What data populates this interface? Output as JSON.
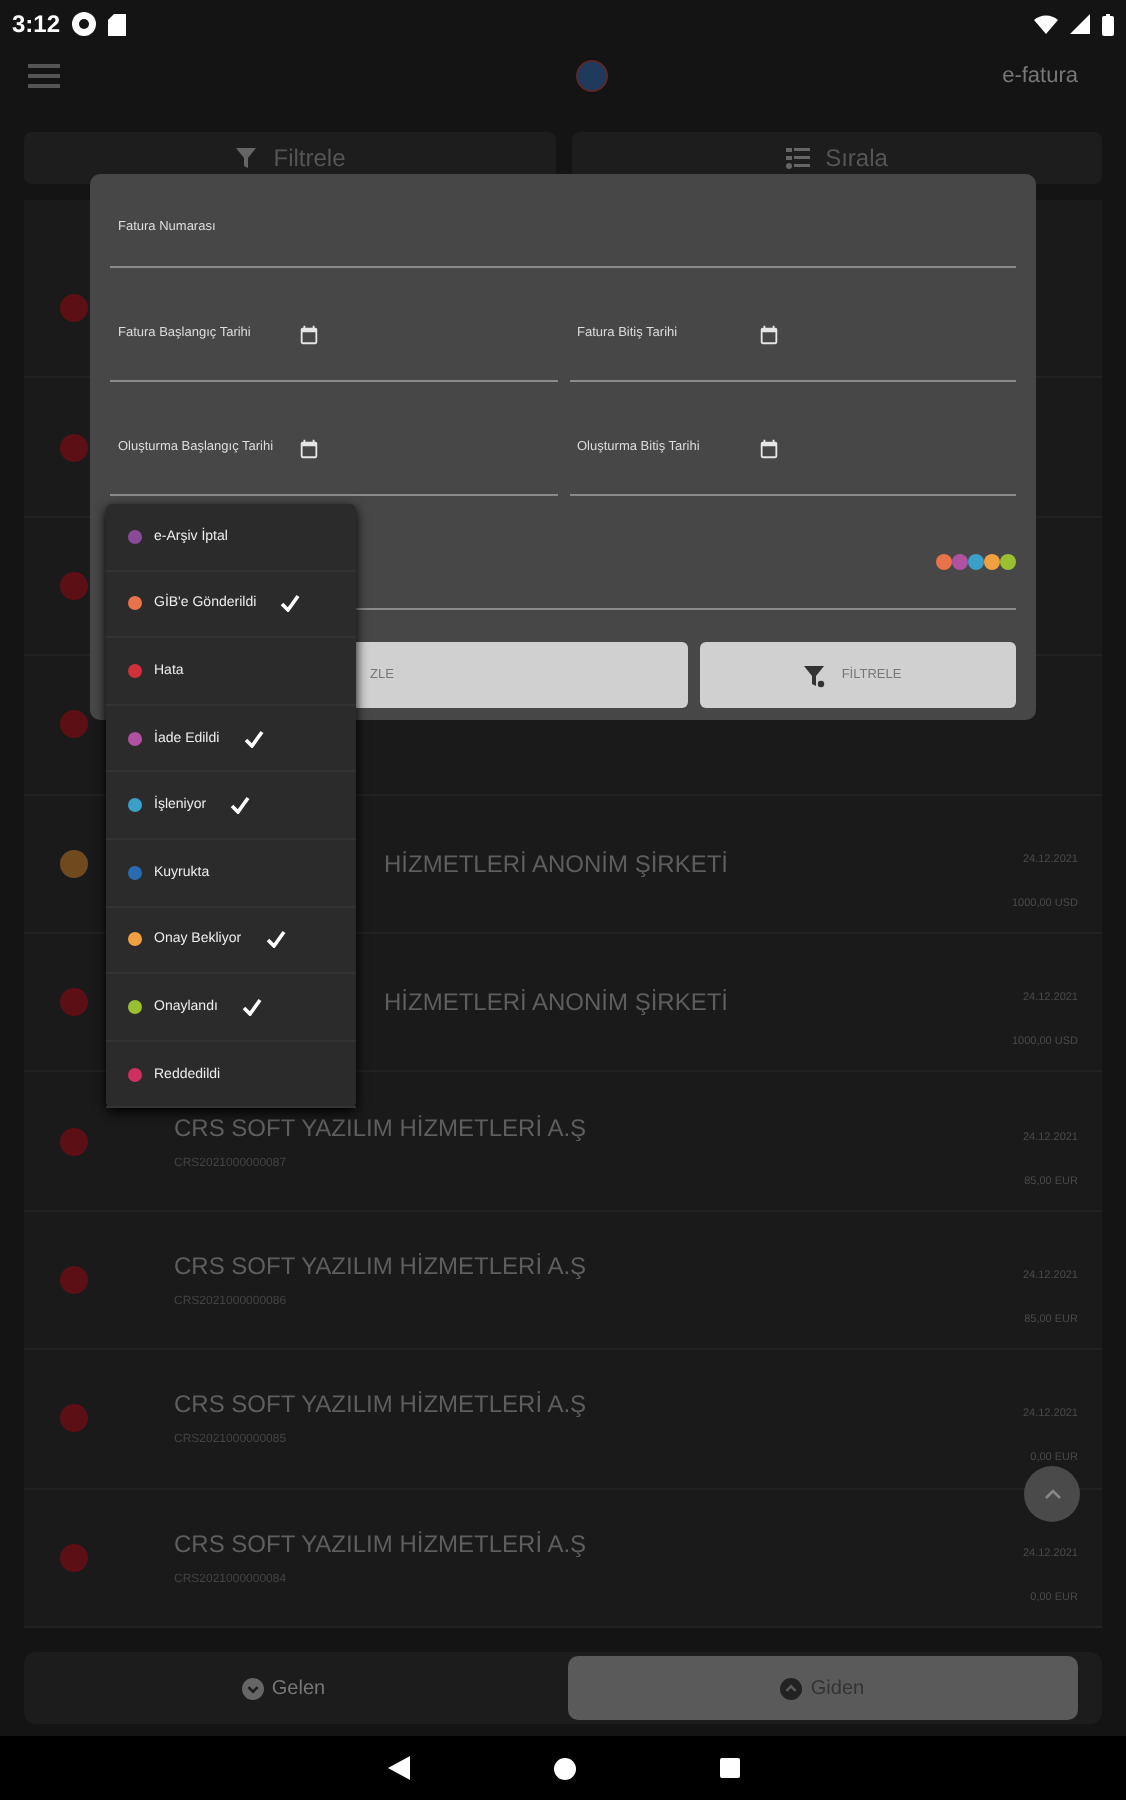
{
  "status_bar": {
    "time": "3:12"
  },
  "app_bar": {
    "title": "e-fatura"
  },
  "toolbar": [
    {
      "kind": "filter",
      "label": "Filtrele"
    },
    {
      "kind": "sort",
      "label": "Sırala"
    }
  ],
  "invoices": [
    {
      "color": "#5c1016"
    },
    {
      "color": "#5c1016"
    },
    {
      "color": "#5c1016"
    },
    {
      "color": "#5c1016"
    },
    {
      "kind": "partial",
      "color": "#6e4a1e",
      "title": "HİZMETLERİ ANONİM ŞİRKETİ",
      "date": "24.12.2021",
      "amount": "1000,00 USD"
    },
    {
      "kind": "partial",
      "color": "#5c1016",
      "title": "HİZMETLERİ ANONİM ŞİRKETİ",
      "date": "24.12.2021",
      "amount": "1000,00 USD"
    },
    {
      "kind": "full",
      "color": "#5c1016",
      "title": "CRS SOFT YAZILIM HİZMETLERİ A.Ş",
      "number": "CRS2021000000087",
      "date": "24.12.2021",
      "amount": "85,00 EUR"
    },
    {
      "kind": "full",
      "color": "#5c1016",
      "title": "CRS SOFT YAZILIM HİZMETLERİ A.Ş",
      "number": "CRS2021000000086",
      "date": "24.12.2021",
      "amount": "85,00 EUR"
    },
    {
      "kind": "full",
      "color": "#5c1016",
      "title": "CRS SOFT YAZILIM HİZMETLERİ A.Ş",
      "number": "CRS2021000000085",
      "date": "24.12.2021",
      "amount": "0,00 EUR"
    },
    {
      "kind": "full",
      "color": "#5c1016",
      "title": "CRS SOFT YAZILIM HİZMETLERİ A.Ş",
      "number": "CRS2021000000084",
      "date": "24.12.2021",
      "amount": "0,00 EUR"
    }
  ],
  "filter_dialog": {
    "invoice_number": {
      "placeholder": "Fatura Numarası"
    },
    "date_rows": [
      [
        {
          "placeholder": "Fatura Başlangıç Tarihi"
        },
        {
          "placeholder": "Fatura Bitiş Tarihi"
        }
      ],
      [
        {
          "placeholder": "Oluşturma Başlangıç Tarihi"
        },
        {
          "placeholder": "Oluşturma Bitiş Tarihi"
        }
      ]
    ],
    "clear_button": "ZLE",
    "filter_button": "FİLTRELE"
  },
  "status_options": [
    {
      "label": "e-Arşiv İptal",
      "color": "#8a4a9a",
      "checked": false
    },
    {
      "label": "GİB'e Gönderildi",
      "color": "#e8734a",
      "checked": true
    },
    {
      "label": "Hata",
      "color": "#d0303a",
      "checked": false
    },
    {
      "label": "İade Edildi",
      "color": "#b050a0",
      "checked": true
    },
    {
      "label": "İşleniyor",
      "color": "#3aa0c8",
      "checked": true
    },
    {
      "label": "Kuyrukta",
      "color": "#2a6ab0",
      "checked": false
    },
    {
      "label": "Onay Bekliyor",
      "color": "#f0a040",
      "checked": true
    },
    {
      "label": "Onaylandı",
      "color": "#98c030",
      "checked": true
    },
    {
      "label": "Reddedildi",
      "color": "#d03060",
      "checked": false
    }
  ],
  "bottom_tabs": [
    {
      "kind": "incoming",
      "label": "Gelen",
      "selected": false
    },
    {
      "kind": "outgoing",
      "label": "Giden",
      "selected": true
    }
  ]
}
